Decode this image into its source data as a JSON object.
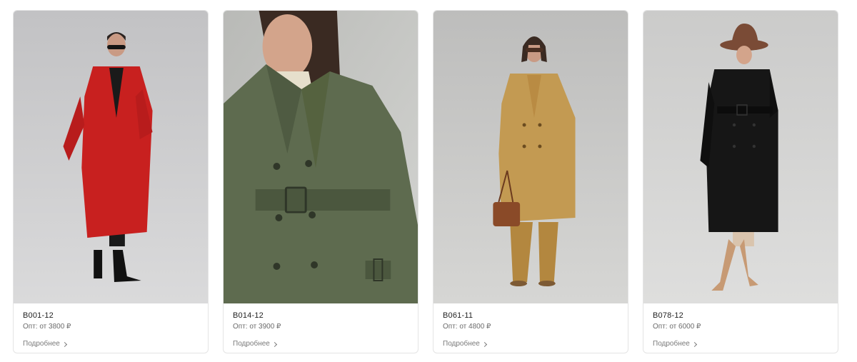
{
  "products": [
    {
      "sku": "B001-12",
      "price": "Опт: от 3800 ₽",
      "more_label": "Подробнее",
      "coat_color": "#c8201f",
      "bg_color": "#c9c9cb"
    },
    {
      "sku": "B014-12",
      "price": "Опт: от 3900 ₽",
      "more_label": "Подробнее",
      "coat_color": "#5e6b4f",
      "bg_color": "#c4c5c2"
    },
    {
      "sku": "B061-11",
      "price": "Опт: от 4800 ₽",
      "more_label": "Подробнее",
      "coat_color": "#c39a52",
      "bg_color": "#c6c6c5"
    },
    {
      "sku": "B078-12",
      "price": "Опт: от 6000 ₽",
      "more_label": "Подробнее",
      "coat_color": "#161616",
      "bg_color": "#d4d4d3"
    }
  ]
}
